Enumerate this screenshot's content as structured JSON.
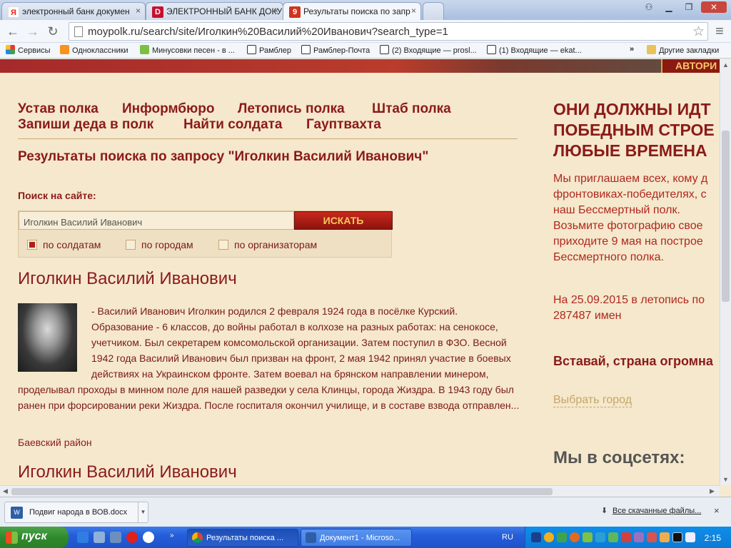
{
  "browser": {
    "tabs": [
      {
        "label": "электронный банк докумен",
        "favicon": "Я"
      },
      {
        "label": "ЭЛЕКТРОННЫЙ БАНК ДОКУ",
        "favicon": "D"
      },
      {
        "label": "Результаты поиска по запр",
        "favicon": "9"
      }
    ],
    "url": "moypolk.ru/search/site/Иголкин%20Василий%20Иванович?search_type=1",
    "bookmarks": [
      {
        "label": "Сервисы"
      },
      {
        "label": "Одноклассники"
      },
      {
        "label": "Минусовки песен - в ..."
      },
      {
        "label": "Рамблер"
      },
      {
        "label": "Рамблер-Почта"
      },
      {
        "label": "(2) Входящие — prosl..."
      },
      {
        "label": "(1) Входящие — ekat..."
      }
    ],
    "bookmarks_more": "»",
    "other_bookmarks": "Другие закладки"
  },
  "site": {
    "banner_button": "АВТОРИ",
    "nav": [
      {
        "label": "Устав полка"
      },
      {
        "label": "Информбюро"
      },
      {
        "label": "Летопись полка"
      },
      {
        "label": "Штаб полка"
      },
      {
        "label": "Запиши деда в полк"
      },
      {
        "label": "Найти солдата"
      },
      {
        "label": "Гауптвахта"
      }
    ],
    "results_title": "Результаты поиска по запросу \"Иголкин Василий Иванович\"",
    "search": {
      "label": "Поиск на сайте:",
      "value": "Иголкин Василий Иванович",
      "button": "ИСКАТЬ",
      "options": [
        {
          "label": "по солдатам",
          "checked": true
        },
        {
          "label": "по городам",
          "checked": false
        },
        {
          "label": "по организаторам",
          "checked": false
        }
      ]
    },
    "results": [
      {
        "name": "Иголкин Василий Иванович",
        "bio": "- Василий Иванович Иголкин родился 2 февраля 1924 года в посёлке Курский. Образование - 6 классов, до войны работал в колхозе на разных работах: на сенокосе, учетчиком. Был секретарем комсомольской организации. Затем поступил в ФЗО. Весной 1942 года Василий Иванович был призван на фронт, 2 мая 1942 принял участие в боевых действиях на Украинском фронте. Затем воевал на брянском направлении минером, проделывал проходы в минном поле для нашей разведки у села Клинцы, города Жиздра. В 1943 году был ранен при форсировании реки Жиздра. После госпиталя окончил училище, и в составе взвода отправлен...",
        "district": "Баевский район"
      },
      {
        "name": "Иголкин Василий Иванович"
      }
    ],
    "sidebar": {
      "heading_lines": [
        "ОНИ ДОЛЖНЫ ИДТ",
        "ПОБЕДНЫМ СТРОЕ",
        "ЛЮБЫЕ ВРЕМЕНА"
      ],
      "text_lines": [
        "Мы приглашаем всех, кому д",
        "фронтовиках-победителях, с",
        "наш Бессмертный полк.",
        "Возьмите фотографию свое",
        "приходите 9 мая на построе",
        "Бессмертного полка."
      ],
      "stat_lines": [
        "На 25.09.2015 в летопись по",
        "287487 имен"
      ],
      "slogan": "Вставай, страна огромна",
      "city_link": "Выбрать город",
      "social_heading": "Мы в соцсетях:"
    }
  },
  "downloads": {
    "file": "Подвиг народа в ВОВ.docx",
    "all_link": "Все скачанные файлы...",
    "close": "×"
  },
  "taskbar": {
    "start": "пуск",
    "tasks": [
      {
        "label": "Результаты поиска ..."
      },
      {
        "label": "Документ1 - Microso..."
      }
    ],
    "lang": "RU",
    "clock": "2:15"
  },
  "colors": {
    "accent": "#8b1a1a",
    "page_bg": "#f5e8cc",
    "button_gold": "#f6c75a"
  }
}
